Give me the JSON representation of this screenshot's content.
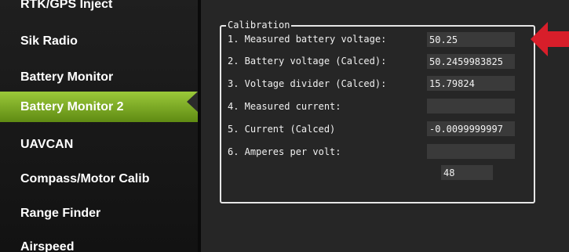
{
  "sidebar": {
    "items": [
      {
        "label": "RTK/GPS Inject"
      },
      {
        "label": "Sik Radio"
      },
      {
        "label": "Battery Monitor"
      },
      {
        "label": "Battery Monitor 2",
        "active": true
      },
      {
        "label": "UAVCAN"
      },
      {
        "label": "Compass/Motor Calib"
      },
      {
        "label": "Range Finder"
      },
      {
        "label": "Airspeed"
      }
    ]
  },
  "calibration": {
    "title": "Calibration",
    "rows": [
      {
        "label": "1. Measured battery voltage:",
        "value": "50.25"
      },
      {
        "label": "2. Battery voltage (Calced):",
        "value": "50.2459983825"
      },
      {
        "label": "3. Voltage divider (Calced):",
        "value": "15.79824"
      },
      {
        "label": "4. Measured current:",
        "value": ""
      },
      {
        "label": "5. Current (Calced)",
        "value": "-0.0099999997"
      },
      {
        "label": "6. Amperes per volt:",
        "value": ""
      }
    ],
    "extra_value": "48"
  },
  "colors": {
    "active_item": "#7fae25",
    "arrow": "#d81e2a"
  },
  "icons": {
    "pointer": "red-arrow-icon"
  }
}
